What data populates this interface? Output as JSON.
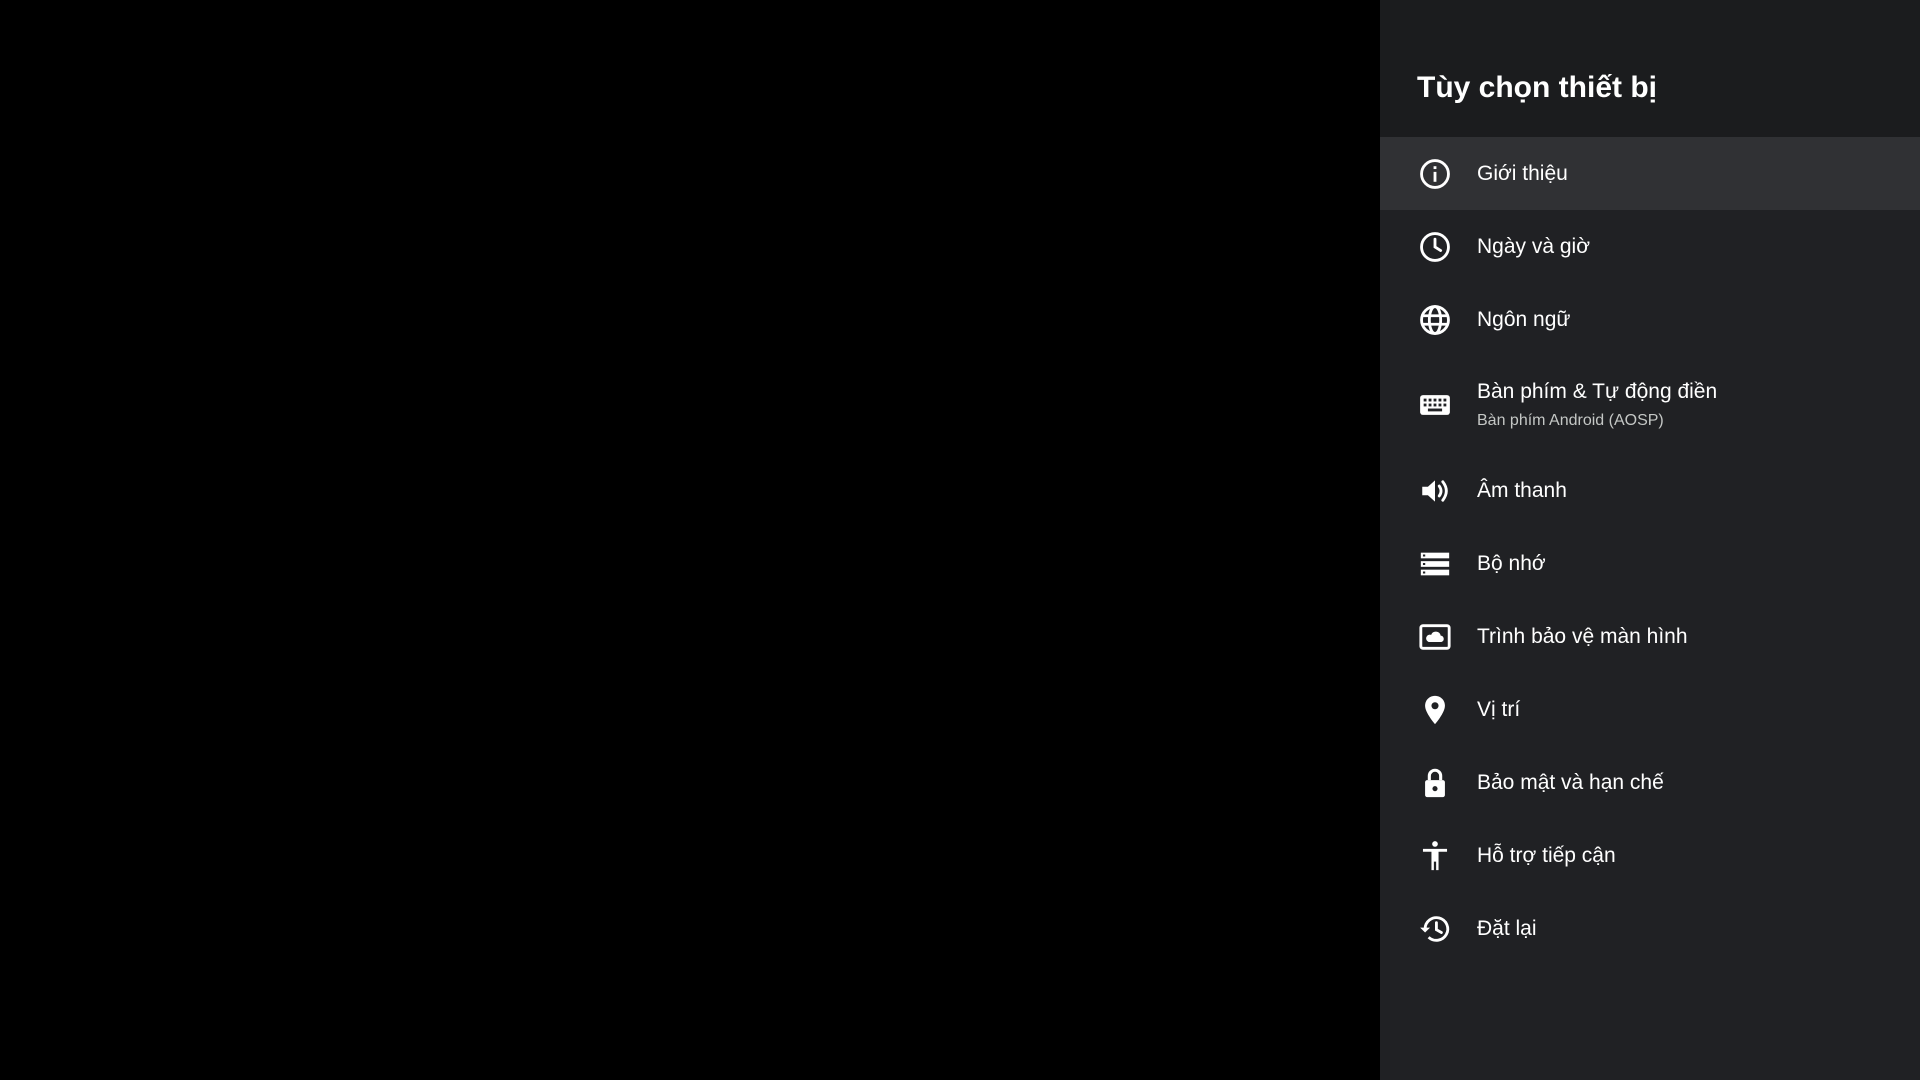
{
  "panel": {
    "title": "Tùy chọn thiết bị",
    "background": "#202124",
    "header_background": "#1b1c1e",
    "selected_background": "#303134"
  },
  "menu": {
    "items": [
      {
        "label": "Giới thiệu",
        "icon": "info-icon",
        "selected": true
      },
      {
        "label": "Ngày và giờ",
        "icon": "clock-icon"
      },
      {
        "label": "Ngôn ngữ",
        "icon": "globe-icon"
      },
      {
        "label": "Bàn phím & Tự động điền",
        "subtitle": "Bàn phím Android (AOSP)",
        "icon": "keyboard-icon"
      },
      {
        "label": "Âm thanh",
        "icon": "volume-icon"
      },
      {
        "label": "Bộ nhớ",
        "icon": "storage-icon"
      },
      {
        "label": "Trình bảo vệ màn hình",
        "icon": "screensaver-icon"
      },
      {
        "label": "Vị trí",
        "icon": "location-pin-icon"
      },
      {
        "label": "Bảo mật và hạn chế",
        "icon": "lock-icon"
      },
      {
        "label": "Hỗ trợ tiếp cận",
        "icon": "accessibility-icon"
      },
      {
        "label": "Đặt lại",
        "icon": "restore-icon"
      }
    ]
  }
}
